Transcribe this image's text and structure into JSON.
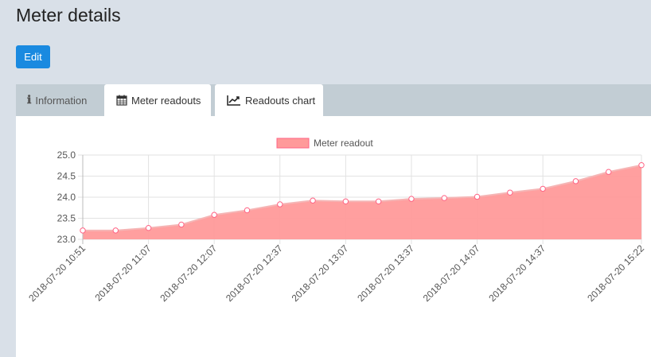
{
  "page": {
    "title": "Meter details"
  },
  "actions": {
    "edit_label": "Edit"
  },
  "tabs": [
    {
      "label": "Information",
      "icon": "info-icon"
    },
    {
      "label": "Meter readouts",
      "icon": "calendar-icon"
    },
    {
      "label": "Readouts chart",
      "icon": "line-chart-icon"
    }
  ],
  "colors": {
    "accent": "#1a8ae0",
    "series_fill": "#ff9a9a",
    "series_line": "#ff6384"
  },
  "chart_data": {
    "type": "area",
    "legend": "top",
    "grid": true,
    "ylim": [
      23.0,
      25.0
    ],
    "yticks": [
      "25.0",
      "24.5",
      "24.0",
      "23.5",
      "23.0"
    ],
    "xticks": [
      "2018-07-20 10:51",
      "2018-07-20 11:07",
      "2018-07-20 12:07",
      "2018-07-20 12:37",
      "2018-07-20 13:07",
      "2018-07-20 13:37",
      "2018-07-20 14:07",
      "2018-07-20 14:37",
      "2018-07-20 15:22"
    ],
    "series": [
      {
        "name": "Meter readout",
        "values": [
          23.21,
          23.21,
          23.27,
          23.35,
          23.58,
          23.69,
          23.83,
          23.92,
          23.9,
          23.9,
          23.96,
          23.98,
          24.01,
          24.11,
          24.2,
          24.38,
          24.6,
          24.76
        ]
      }
    ]
  }
}
